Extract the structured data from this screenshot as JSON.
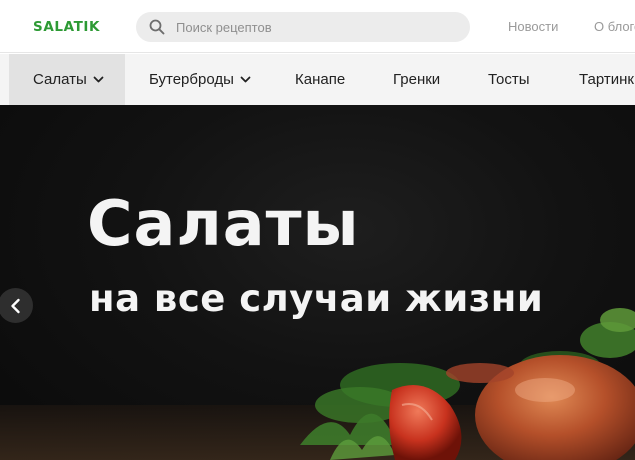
{
  "header": {
    "logo": "SALATIK",
    "search": {
      "placeholder": "Поиск рецептов"
    },
    "links": [
      "Новости",
      "О блоге"
    ]
  },
  "menu": {
    "items": [
      {
        "label": "Салаты",
        "has_dropdown": true,
        "active": true
      },
      {
        "label": "Бутерброды",
        "has_dropdown": true,
        "active": false
      },
      {
        "label": "Канапе",
        "has_dropdown": false,
        "active": false
      },
      {
        "label": "Гренки",
        "has_dropdown": false,
        "active": false
      },
      {
        "label": "Тосты",
        "has_dropdown": false,
        "active": false
      },
      {
        "label": "Тартинки",
        "has_dropdown": false,
        "active": false
      }
    ]
  },
  "hero": {
    "title": "Салаты",
    "subtitle": "на все случаи жизни",
    "prev_icon": "chevron-left-icon"
  },
  "colors": {
    "brand": "#2d9a34",
    "menu_bg": "#f4f4f4",
    "menu_active_bg": "#e2e2e2",
    "hero_bg": "#121212"
  }
}
